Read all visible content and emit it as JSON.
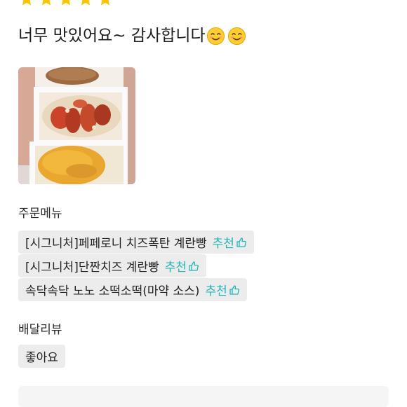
{
  "rating": {
    "stars": 5,
    "max": 5,
    "color": "#f7c600"
  },
  "review": {
    "text": "너무 맛있어요~ 감사합니다",
    "emojis": [
      "smiling-face-icon",
      "smiling-face-icon"
    ]
  },
  "photo": {
    "icon": "food-photo"
  },
  "order_menu": {
    "title": "주문메뉴",
    "items": [
      {
        "name": "[시그니처]페페로니 치즈폭탄 계란빵",
        "recommend": "추천"
      },
      {
        "name": "[시그니처]단짠치즈 계란빵",
        "recommend": "추천"
      },
      {
        "name": "속닥속닥 노노 소떡소떡(마약 소스)",
        "recommend": "추천"
      }
    ]
  },
  "delivery_review": {
    "title": "배달리뷰",
    "tag": "좋아요"
  },
  "colors": {
    "accent": "#1fb5b5",
    "chip_bg": "#ececec"
  }
}
